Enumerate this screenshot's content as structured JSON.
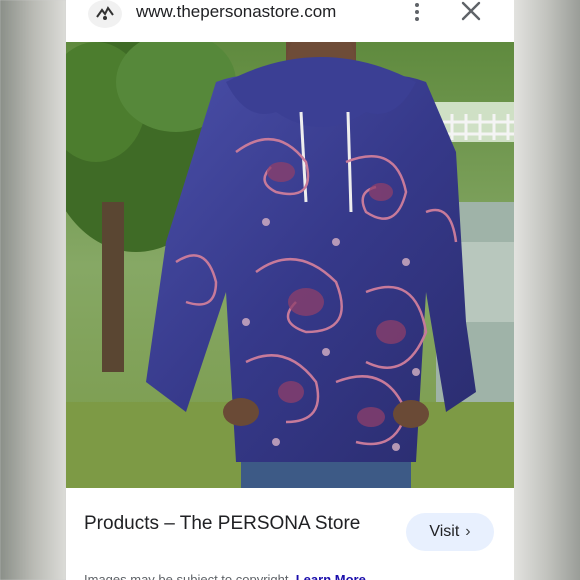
{
  "browser": {
    "url": "www.thepersonastore.com"
  },
  "icons": {
    "favicon": "persona-logo-icon",
    "menu": "more-vertical-icon",
    "close": "close-icon",
    "visit_arrow": "chevron-right-icon"
  },
  "result": {
    "title": "Products – The PERSONA Store",
    "visit_label": "Visit",
    "visit_chevron": "›",
    "copyright_text": "Images may be subject to copyright.",
    "learn_more": "Learn More"
  },
  "colors": {
    "visit_bg": "#e8f0fe",
    "hoodie_base": "#3b3f8f",
    "paisley_accent": "#a24a6a"
  }
}
